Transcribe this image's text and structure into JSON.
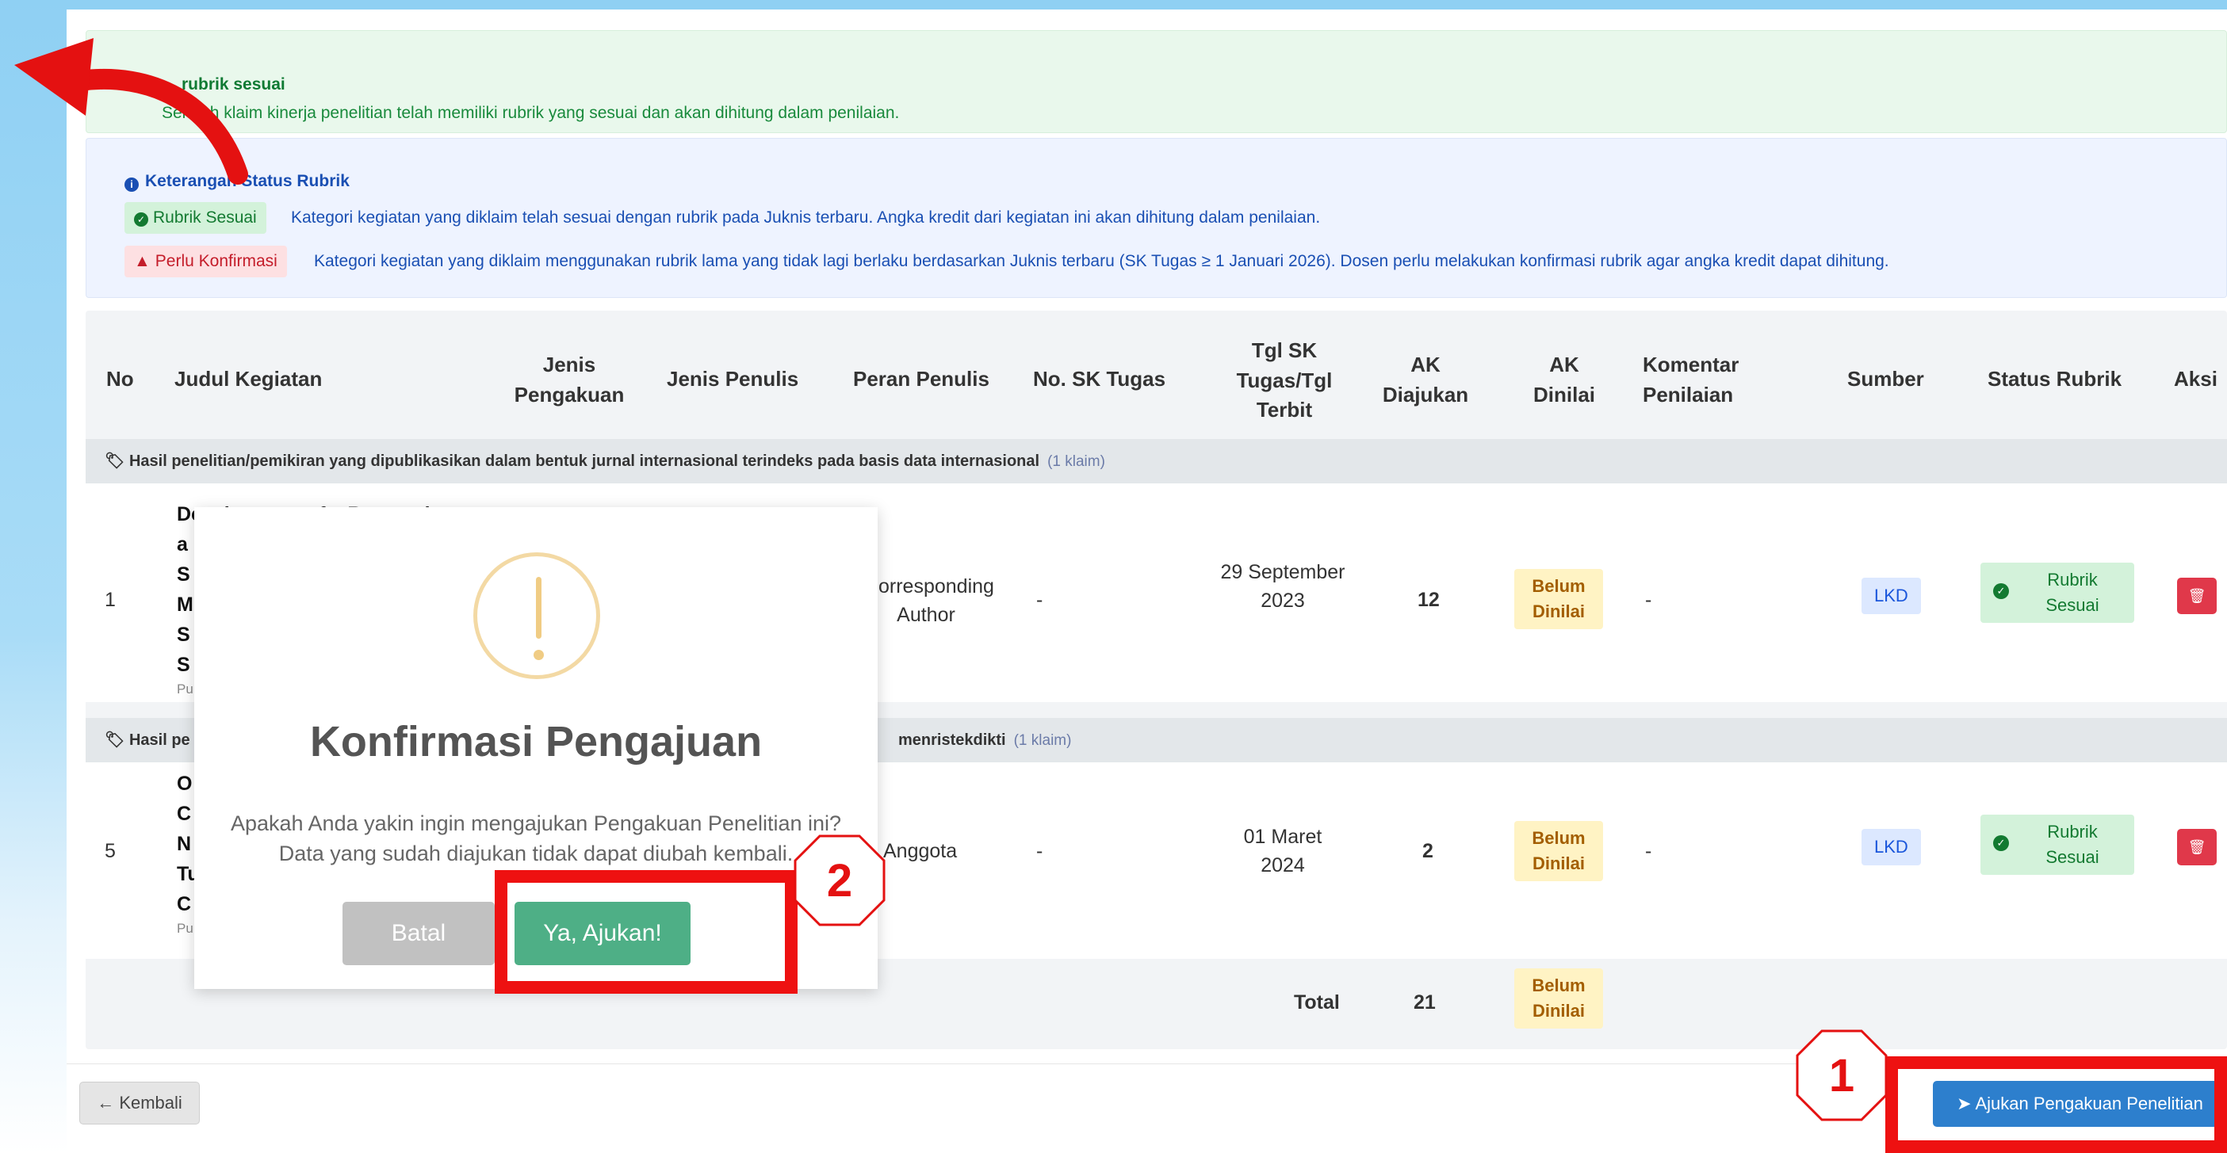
{
  "colors": {
    "accent": "#2d7fcd",
    "success": "#137a31",
    "danger": "#e0384a",
    "warning": "#a35e00",
    "highlight": "#ee1111"
  },
  "success_alert": {
    "title": "rubrik sesuai",
    "text": "Seluruh klaim kinerja penelitian telah memiliki rubrik yang sesuai dan akan dihitung dalam penilaian."
  },
  "info": {
    "title": "Keterangan Status Rubrik",
    "ok_label": "Rubrik Sesuai",
    "ok_text": "Kategori kegiatan yang diklaim telah sesuai dengan rubrik pada Juknis terbaru. Angka kredit dari kegiatan ini akan dihitung dalam penilaian.",
    "warn_label": "Perlu Konfirmasi",
    "warn_text": "Kategori kegiatan yang diklaim menggunakan rubrik lama yang tidak lagi berlaku berdasarkan Juknis terbaru (SK Tugas ≥ 1 Januari 2026). Dosen perlu melakukan konfirmasi rubrik agar angka kredit dapat dihitung."
  },
  "table": {
    "headers": {
      "no": "No",
      "judul": "Judul Kegiatan",
      "jenis_pengakuan": "Jenis Pengakuan",
      "jenis_penulis": "Jenis Penulis",
      "peran": "Peran Penulis",
      "no_sk": "No. SK Tugas",
      "tgl": "Tgl SK Tugas/Tgl Terbit",
      "ak_diajukan": "AK Diajukan",
      "ak_dinilai": "AK Dinilai",
      "komentar": "Komentar Penilaian",
      "sumber": "Sumber",
      "status": "Status Rubrik",
      "aksi": "Aksi"
    },
    "groups": [
      {
        "label": "Hasil penelitian/pemikiran yang dipublikasikan dalam bentuk jurnal internasional terindeks pada basis data internasional",
        "count": "(1 klaim)"
      },
      {
        "label": "Hasil pe",
        "tail": "menristekdikti",
        "count": "(1 klaim)"
      }
    ],
    "rows": [
      {
        "no": "1",
        "title_lines": [
          "Development of a Research",
          "a",
          "S",
          "M",
          "S",
          "S"
        ],
        "sub": "Pu",
        "peran": "orresponding Author",
        "no_sk": "-",
        "tgl": "29 September 2023",
        "ak": "12",
        "dinilai": "Belum Dinilai",
        "komentar": "-",
        "sumber": "LKD",
        "status": "Rubrik Sesuai"
      },
      {
        "no": "5",
        "title_lines": [
          "O",
          "C",
          "N",
          "Tu",
          "C"
        ],
        "sub": "Pu",
        "peran": "Anggota",
        "no_sk": "-",
        "tgl": "01 Maret 2024",
        "ak": "2",
        "dinilai": "Belum Dinilai",
        "komentar": "-",
        "sumber": "LKD",
        "status": "Rubrik Sesuai"
      }
    ],
    "total_label": "Total",
    "total_value": "21",
    "total_status": "Belum Dinilai"
  },
  "footer": {
    "back_label": "Kembali",
    "submit_label": "Ajukan Pengakuan Penelitian"
  },
  "modal": {
    "title": "Konfirmasi Pengajuan",
    "line1": "Apakah Anda yakin ingin mengajukan Pengakuan Penelitian ini?",
    "line2": "Data yang sudah diajukan tidak dapat diubah kembali.",
    "cancel": "Batal",
    "confirm": "Ya, Ajukan!"
  },
  "annotations": {
    "step1": "1",
    "step2": "2"
  }
}
